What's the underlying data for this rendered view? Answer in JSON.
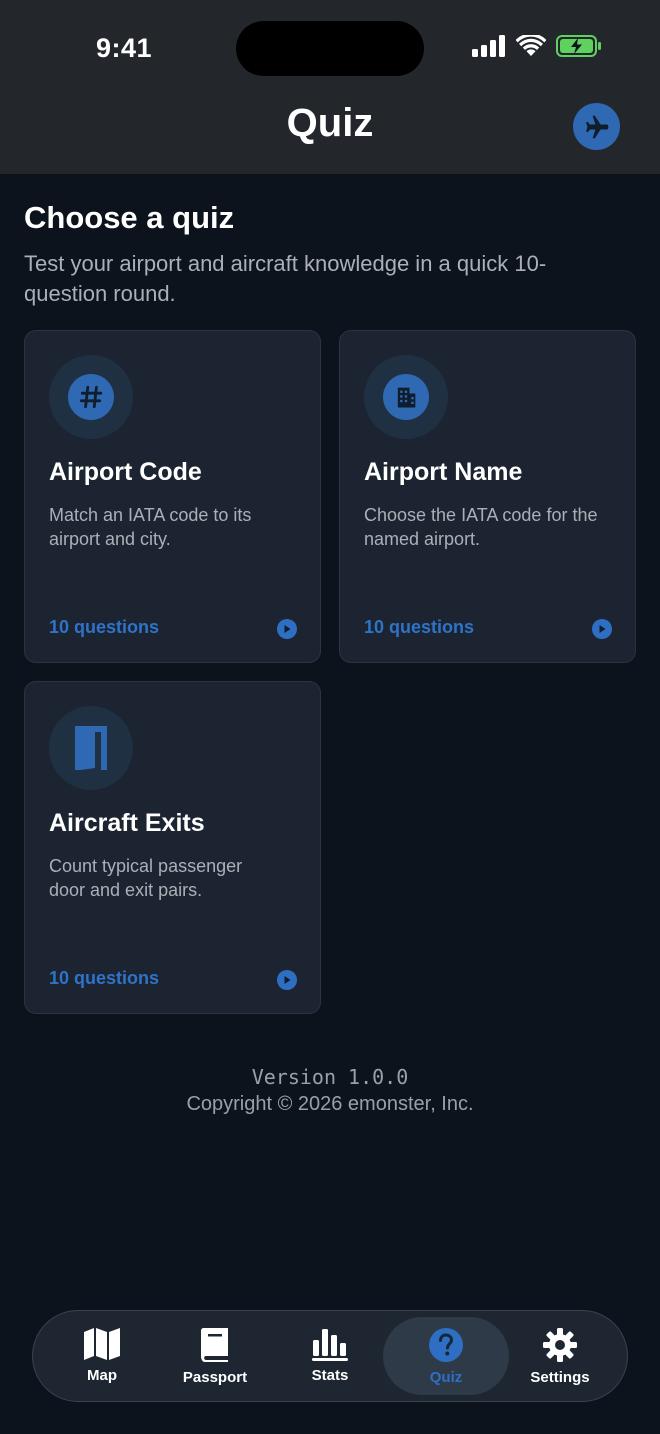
{
  "status_bar": {
    "time": "9:41"
  },
  "header": {
    "title": "Quiz",
    "action_icon": "airplane-icon"
  },
  "intro": {
    "title": "Choose a quiz",
    "subtitle_line1": "Test your airport and aircraft knowledge in a quick 10-",
    "subtitle_line2": "question round."
  },
  "cards": [
    {
      "title": "Airport Code",
      "desc_line1": "Match an IATA code to its",
      "desc_line2": "airport and city.",
      "count": "10 questions",
      "icon": "hash-icon"
    },
    {
      "title": "Airport Name",
      "desc_line1": "Choose the IATA code for the",
      "desc_line2": "named airport.",
      "count": "10 questions",
      "icon": "building-icon"
    },
    {
      "title": "Aircraft Exits",
      "desc_line1": "Count typical passenger",
      "desc_line2": "door and exit pairs.",
      "count": "10 questions",
      "icon": "door-icon"
    }
  ],
  "footer": {
    "version": "Version 1.0.0",
    "copyright": "Copyright © 2026 emonster, Inc."
  },
  "tabbar": {
    "items": [
      {
        "label": "Map",
        "icon": "map-icon"
      },
      {
        "label": "Passport",
        "icon": "book-icon"
      },
      {
        "label": "Stats",
        "icon": "chart-icon"
      },
      {
        "label": "Quiz",
        "icon": "question-icon",
        "active": true
      },
      {
        "label": "Settings",
        "icon": "gear-icon"
      }
    ]
  },
  "colors": {
    "accent": "#2f6fc3",
    "background": "#0d131c",
    "card": "#1b2430",
    "header": "#23272c"
  }
}
